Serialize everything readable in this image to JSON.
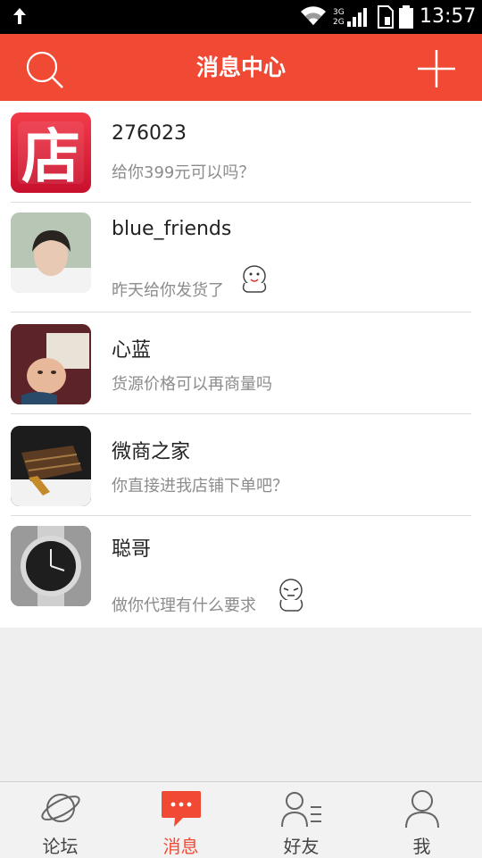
{
  "status_bar": {
    "network_top": "3G",
    "network_bottom": "2G",
    "time": "13:57"
  },
  "header": {
    "title": "消息中心",
    "background": "#f04a34"
  },
  "conversations": [
    {
      "name": "276023",
      "message": "给你399元可以吗？",
      "avatar": "shop-logo",
      "sticker": false
    },
    {
      "name": "blue_friends",
      "message": "昨天给你发货了",
      "avatar": "person-photo",
      "sticker": true
    },
    {
      "name": "心蓝",
      "message": "货源价格可以再商量吗",
      "avatar": "baby-photo",
      "sticker": false
    },
    {
      "name": "微商之家",
      "message": "你直接进我店铺下单吧？",
      "avatar": "handbag-photo",
      "sticker": false
    },
    {
      "name": "聪哥",
      "message": "做你代理有什么要求",
      "avatar": "watch-photo",
      "sticker": true
    }
  ],
  "tabs": [
    {
      "label": "论坛",
      "icon": "planet-icon",
      "active": false
    },
    {
      "label": "消息",
      "icon": "chat-bubble-icon",
      "active": true
    },
    {
      "label": "好友",
      "icon": "friends-icon",
      "active": false
    },
    {
      "label": "我",
      "icon": "person-icon",
      "active": false
    }
  ],
  "colors": {
    "accent": "#f04a34",
    "text_secondary": "#8c8c8c"
  }
}
